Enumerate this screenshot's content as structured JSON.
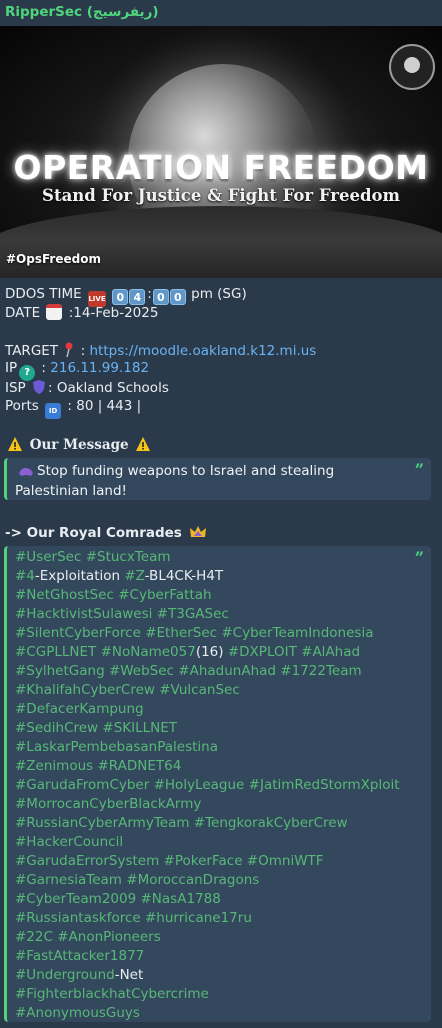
{
  "channel": {
    "name": "RipperSec (ريفرسيج)"
  },
  "banner": {
    "title": "OPERATION FREEDOM",
    "subtitle": "Stand For Justice & Fight For Freedom",
    "hashtag": "#OpsFreedom"
  },
  "details": {
    "ddos_label": "DDOS TIME",
    "time_digits": [
      "0",
      "4",
      "0",
      "0"
    ],
    "time_suffix": "pm (SG)",
    "date_label": "DATE",
    "date_value": ":14-Feb-2025",
    "target_label": "TARGET",
    "target_url": "https://moodle.oakland.k12.mi.us",
    "ip_label": "IP",
    "ip_value": "216.11.99.182",
    "isp_label": "ISP",
    "isp_value": ": Oakland Schools",
    "ports_label": "Ports",
    "ports_value": ": 80 | 443 |"
  },
  "message": {
    "heading": "Our Message",
    "text": "Stop funding weapons to Israel and stealing Palestinian land!"
  },
  "comrades": {
    "heading": "-> Our Royal Comrades",
    "lines": [
      "#UserSec #StucxTeam",
      "#4-Exploitation #Z-BL4CK-H4T",
      "#NetGhostSec #CyberFattah",
      "#HacktivistSulawesi #T3GASec",
      "#SilentCyberForce #EtherSec #CyberTeamIndonesia",
      "#CGPLLNET #NoName057(16) #DXPLOIT #AlAhad",
      "#SylhetGang #WebSec #AhadunAhad #1722Team",
      "#KhalifahCyberCrew #VulcanSec",
      "#DefacerKampung",
      "#SedihCrew #SKILLNET",
      "#LaskarPembebasanPalestina",
      "#Zenimous #RADNET64",
      "#GarudaFromCyber #HolyLeague  #JatimRedStormXploit",
      "#MorrocanCyberBlackArmy",
      "#RussianCyberArmyTeam  #TengkorakCyberCrew",
      "#HackerCouncil",
      "#GarudaErrorSystem #PokerFace #OmniWTF",
      "#GarnesiaTeam #MoroccanDragons",
      "#CyberTeam2009 #NasA1788",
      "#Russiantaskforce #hurricane17ru",
      "#22C #AnonPioneers",
      "#FastAttacker1877",
      "#Underground-Net",
      "#FighterblackhatCybercrime",
      "#AnonymousGuys"
    ]
  },
  "icons": {
    "live": "live-icon",
    "calendar": "calendar-icon",
    "pin": "pushpin-icon",
    "question": "question-icon",
    "shield": "shield-icon",
    "ports": "id-button-icon",
    "warning": "warning-icon",
    "muscle": "flexed-arm-icon",
    "crown": "crown-icon"
  },
  "colors": {
    "sender": "#4fd67c",
    "link": "#6ab3f3",
    "hashtag": "#58b878",
    "quote_bar": "#4fd67c"
  }
}
